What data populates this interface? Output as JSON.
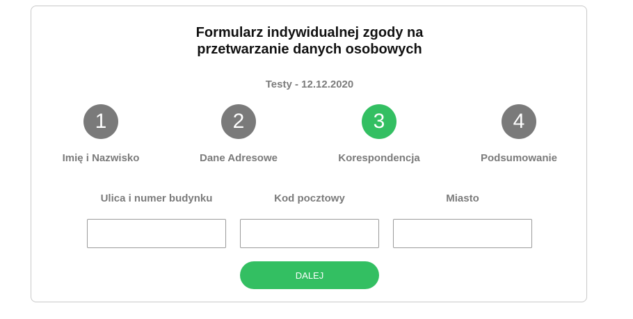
{
  "form": {
    "title_line1": "Formularz indywidualnej zgody na",
    "title_line2": "przetwarzanie danych osobowych",
    "subtitle": "Testy - 12.12.2020"
  },
  "steps": [
    {
      "number": "1",
      "label": "Imię i Nazwisko",
      "active": false
    },
    {
      "number": "2",
      "label": "Dane Adresowe",
      "active": false
    },
    {
      "number": "3",
      "label": "Korespondencja",
      "active": true
    },
    {
      "number": "4",
      "label": "Podsumowanie",
      "active": false
    }
  ],
  "colors": {
    "active_step": "#33bf62",
    "inactive_step": "#7a7a7a",
    "button": "#33bf62"
  },
  "fields": [
    {
      "label": "Ulica i numer budynku",
      "value": "",
      "placeholder": ""
    },
    {
      "label": "Kod pocztowy",
      "value": "",
      "placeholder": ""
    },
    {
      "label": "Miasto",
      "value": "",
      "placeholder": ""
    }
  ],
  "actions": {
    "next_label": "DALEJ"
  }
}
